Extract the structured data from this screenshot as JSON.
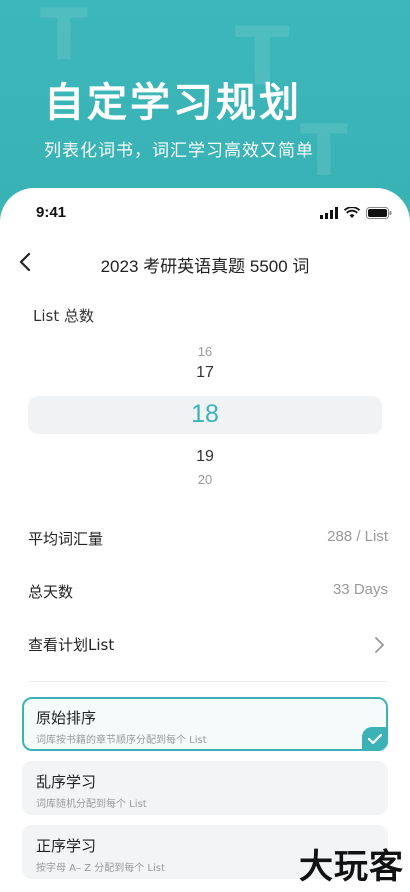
{
  "hero": {
    "title": "自定学习规划",
    "subtitle": "列表化词书，词汇学习高效又简单"
  },
  "status_bar": {
    "time": "9:41"
  },
  "navbar": {
    "title": "2023 考研英语真题 5500 词"
  },
  "picker": {
    "label": "List 总数",
    "options": [
      "16",
      "17",
      "18",
      "19",
      "20"
    ],
    "selected": "18"
  },
  "stats": {
    "avg_label": "平均词汇量",
    "avg_value": "288 / List",
    "days_label": "总天数",
    "days_value": "33 Days",
    "view_plan_label": "查看计划List"
  },
  "orders": [
    {
      "title": "原始排序",
      "desc": "词库按书籍的章节顺序分配到每个 List",
      "selected": true
    },
    {
      "title": "乱序学习",
      "desc": "词库随机分配到每个 List",
      "selected": false
    },
    {
      "title": "正序学习",
      "desc": "按字母 A– Z 分配到每个 List",
      "selected": false
    }
  ],
  "watermark": "大玩客",
  "colors": {
    "accent": "#3bb3b6",
    "hero_bg": "#3bb6b8"
  }
}
